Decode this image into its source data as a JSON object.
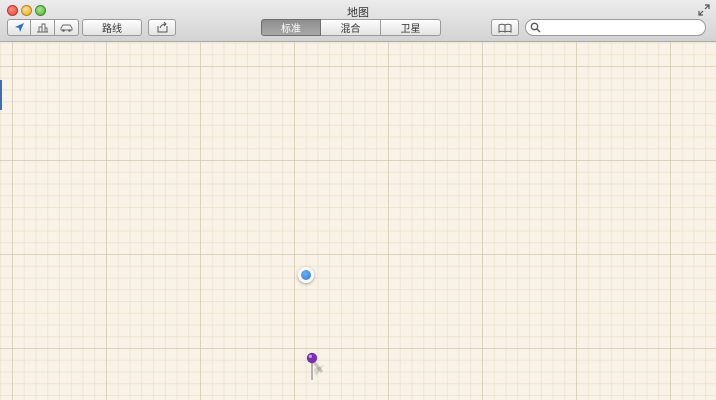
{
  "window": {
    "title": "地图"
  },
  "toolbar": {
    "route_label": "路线",
    "map_modes": [
      {
        "label": "标准",
        "active": true
      },
      {
        "label": "混合",
        "active": false
      },
      {
        "label": "卫星",
        "active": false
      }
    ],
    "icons": [
      "location-arrow-icon",
      "3d-buildings-icon",
      "traffic-car-icon",
      "share-icon",
      "bookmarks-icon",
      "search-icon",
      "fullscreen-icon"
    ]
  },
  "search": {
    "value": "",
    "placeholder": ""
  },
  "colors": {
    "location_dot": "#2b7bd8",
    "pin": "#7b2fb5",
    "map_background": "#f8f3e6"
  }
}
